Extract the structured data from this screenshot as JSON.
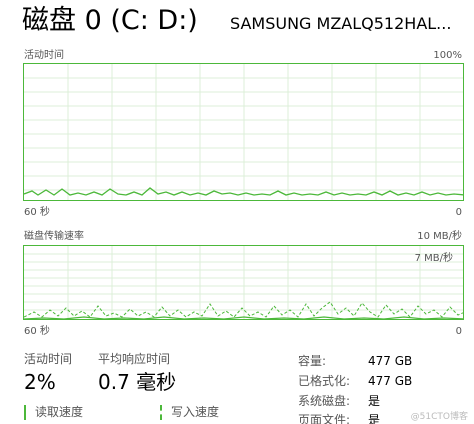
{
  "header": {
    "title": "磁盘 0 (C: D:)",
    "model": "SAMSUNG MZALQ512HAL..."
  },
  "activity_graph": {
    "top_left": "活动时间",
    "top_right": "100%",
    "bottom_left": "60 秒",
    "bottom_right": "0"
  },
  "transfer_graph": {
    "top_left": "磁盘传输速率",
    "top_right": "10 MB/秒",
    "inner_scale": "7 MB/秒",
    "bottom_left": "60 秒",
    "bottom_right": "0"
  },
  "stats": {
    "active_time_label": "活动时间",
    "active_time_value": "2%",
    "response_label": "平均响应时间",
    "response_value": "0.7 毫秒"
  },
  "details": [
    {
      "key": "容量:",
      "value": "477 GB"
    },
    {
      "key": "已格式化:",
      "value": "477 GB"
    },
    {
      "key": "系统磁盘:",
      "value": "是"
    },
    {
      "key": "页面文件:",
      "value": "是"
    }
  ],
  "io": {
    "read_label": "读取速度",
    "write_label": "写入速度"
  },
  "colors": {
    "accent": "#4cb83a",
    "grid": "#dcefd8"
  },
  "watermark": "@51CTO博客"
}
